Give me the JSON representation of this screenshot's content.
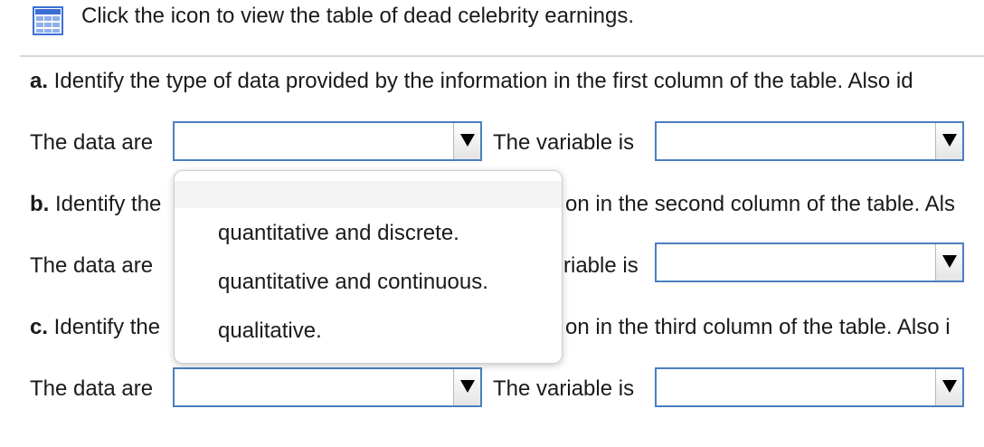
{
  "header": {
    "icon": "table-grid-icon",
    "link_text": "Click the icon to view the table of dead celebrity earnings."
  },
  "questions": [
    {
      "letter": "a.",
      "prompt": " Identify the type of data provided by the information in the first column of the table. Also id",
      "data_label": "The data are",
      "variable_label": "The variable is",
      "data_value": "",
      "variable_value": ""
    },
    {
      "letter": "b.",
      "prompt_left": " Identify the",
      "prompt_right": "on in the second column of the table. Als",
      "data_label": "The data are",
      "variable_label_partial": "riable is",
      "data_value": "",
      "variable_value": ""
    },
    {
      "letter": "c.",
      "prompt_left": " Identify the",
      "prompt_right": "on in the third column of the table. Also i",
      "data_label": "The data are",
      "variable_label": "The variable is",
      "data_value": "",
      "variable_value": ""
    }
  ],
  "dropdown_menu": {
    "options": [
      "",
      "quantitative and discrete.",
      "quantitative and continuous.",
      "qualitative."
    ]
  },
  "colors": {
    "dropdown_border": "#4a7fc1",
    "icon_blue": "#3b6fd6",
    "divider": "#d6d6d6"
  }
}
